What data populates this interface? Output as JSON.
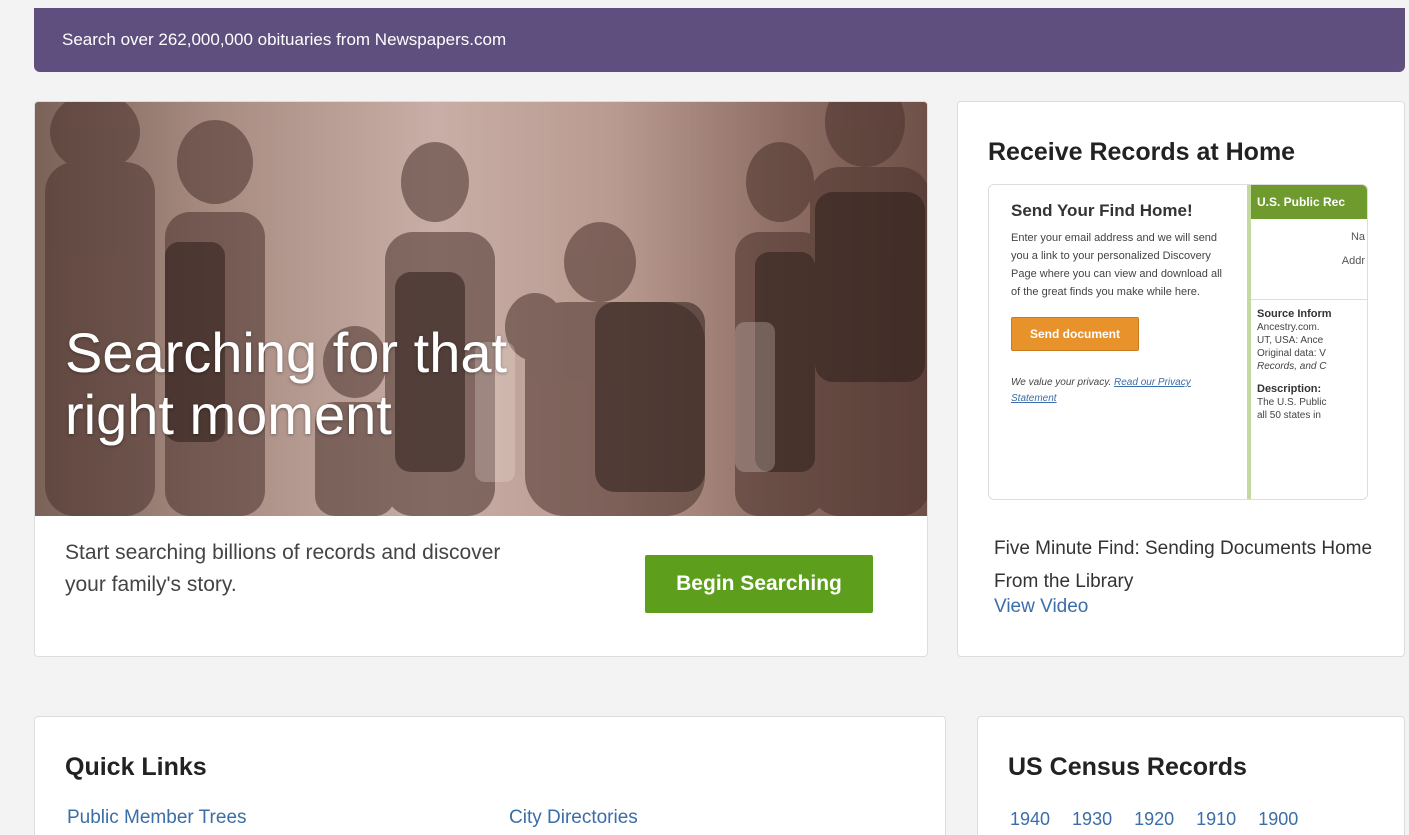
{
  "banner": {
    "text": "Search over 262,000,000 obituaries from Newspapers.com"
  },
  "hero": {
    "headline_line1": "Searching for that",
    "headline_line2": "right moment",
    "subtext": "Start searching billions of records and discover your family's story.",
    "button_label": "Begin Searching"
  },
  "receive": {
    "title": "Receive Records at Home",
    "preview": {
      "title": "Send Your Find Home!",
      "body": "Enter your email address and we will send you a link to your personalized Discovery Page where you can view and download all of the great finds you make while here.",
      "send_label": "Send document",
      "privacy_text": "We value your privacy.",
      "privacy_link": "Read our Privacy Statement",
      "record_header": "U.S. Public Rec",
      "field_name": "Na",
      "field_address": "Addr",
      "source_label": "Source Inform",
      "source_line1": "Ancestry.com.",
      "source_line2": "UT, USA: Ance",
      "source_line3": "Original data: V",
      "source_line4": "Records, and C",
      "description_label": "Description:",
      "description_line1": "The U.S. Public",
      "description_line2": "all 50 states in"
    },
    "caption": "Five Minute Find: Sending Documents Home From the Library",
    "video_link": "View Video"
  },
  "quick_links": {
    "title": "Quick Links",
    "links": [
      "Public Member Trees",
      "City Directories"
    ]
  },
  "census": {
    "title": "US Census Records",
    "years": [
      "1940",
      "1930",
      "1920",
      "1910",
      "1900"
    ]
  },
  "colors": {
    "banner_bg": "#5f4f7e",
    "button_green": "#5e9e1d",
    "link_blue": "#3b6da8",
    "send_orange": "#e8922c"
  }
}
